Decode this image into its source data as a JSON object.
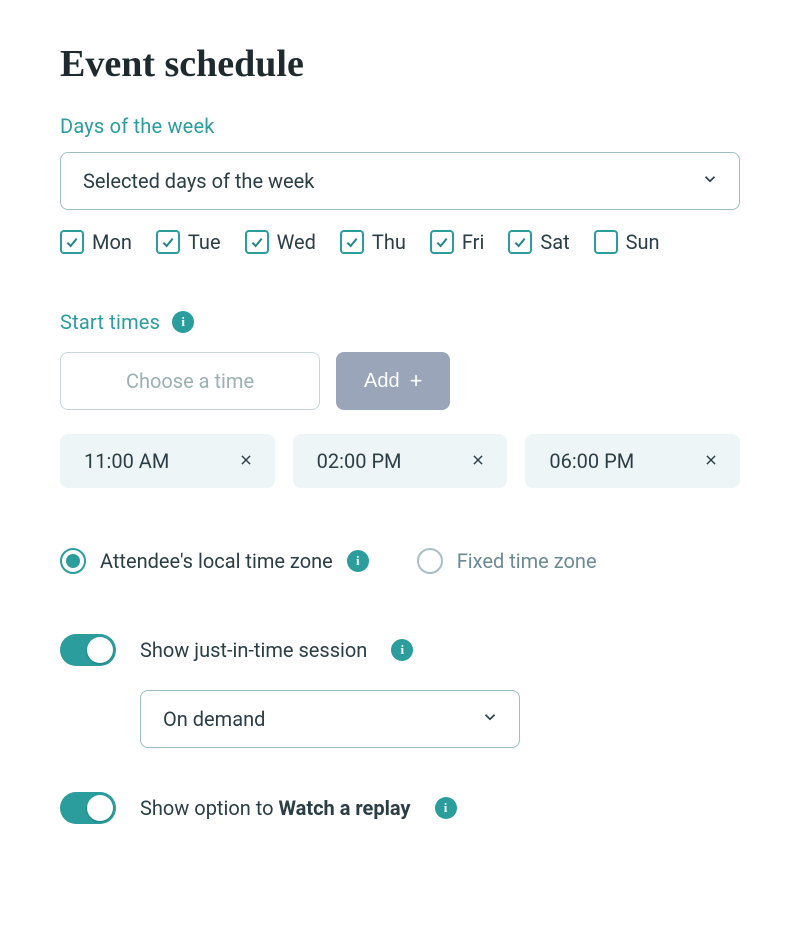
{
  "title": "Event schedule",
  "days_section": {
    "label": "Days of the week",
    "select_value": "Selected days of the week",
    "days": [
      {
        "label": "Mon",
        "checked": true
      },
      {
        "label": "Tue",
        "checked": true
      },
      {
        "label": "Wed",
        "checked": true
      },
      {
        "label": "Thu",
        "checked": true
      },
      {
        "label": "Fri",
        "checked": true
      },
      {
        "label": "Sat",
        "checked": true
      },
      {
        "label": "Sun",
        "checked": false
      }
    ]
  },
  "start_times": {
    "label": "Start times",
    "placeholder": "Choose a time",
    "add_label": "Add",
    "times": [
      "11:00 AM",
      "02:00 PM",
      "06:00 PM"
    ]
  },
  "timezone": {
    "options": [
      {
        "label": "Attendee's local time zone",
        "selected": true,
        "info": true
      },
      {
        "label": "Fixed time zone",
        "selected": false,
        "info": false
      }
    ]
  },
  "jit": {
    "label": "Show just-in-time session",
    "on": true,
    "select_value": "On demand"
  },
  "replay": {
    "prefix": "Show option to ",
    "bold": "Watch a replay",
    "on": true
  }
}
